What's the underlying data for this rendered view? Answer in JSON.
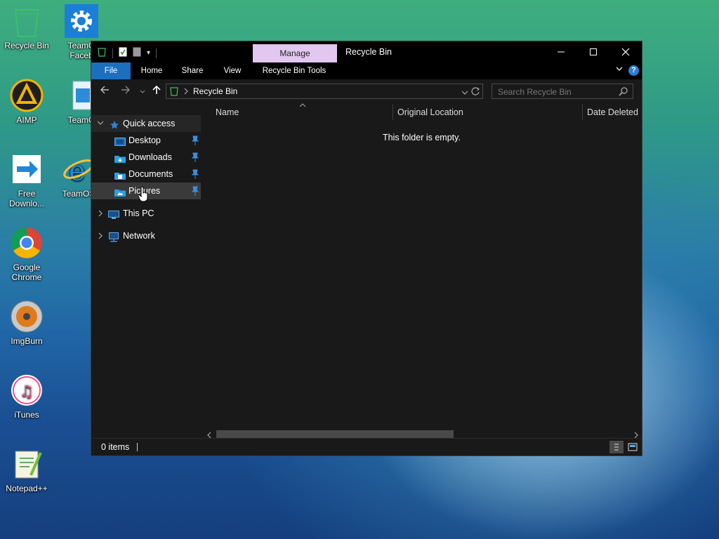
{
  "desktop": {
    "icons": [
      {
        "label": "Recycle Bin",
        "icon": "recycle-bin-icon"
      },
      {
        "label": "TeamO\nFaceb",
        "icon": "gear-icon"
      },
      {
        "label": "AIMP",
        "icon": "aimp-icon"
      },
      {
        "label": "TeamO",
        "icon": "document-icon"
      },
      {
        "label": "Free\nDownlo...",
        "icon": "download-arrow-icon"
      },
      {
        "label": "TeamOS",
        "icon": "internet-explorer-icon"
      },
      {
        "label": "Google\nChrome",
        "icon": "chrome-icon"
      },
      {
        "label": "ImgBurn",
        "icon": "disc-icon"
      },
      {
        "label": "iTunes",
        "icon": "itunes-icon"
      },
      {
        "label": "Notepad++",
        "icon": "notepad-plus-plus-icon"
      }
    ]
  },
  "window": {
    "title": "Recycle Bin",
    "manage_tab": "Manage",
    "ribbon_tabs": [
      "File",
      "Home",
      "Share",
      "View",
      "Recycle Bin Tools"
    ],
    "address": "Recycle Bin",
    "search_placeholder": "Search Recycle Bin",
    "nav": {
      "quick_access": "Quick access",
      "items": [
        "Desktop",
        "Downloads",
        "Documents",
        "Pictures"
      ],
      "this_pc": "This PC",
      "network": "Network"
    },
    "columns": [
      "Name",
      "Original Location",
      "Date Deleted"
    ],
    "empty_message": "This folder is empty.",
    "status": "0 items",
    "colors": {
      "accent": "#1a6fc0",
      "manage_tab": "#e2c7f0",
      "background": "#191919"
    }
  }
}
